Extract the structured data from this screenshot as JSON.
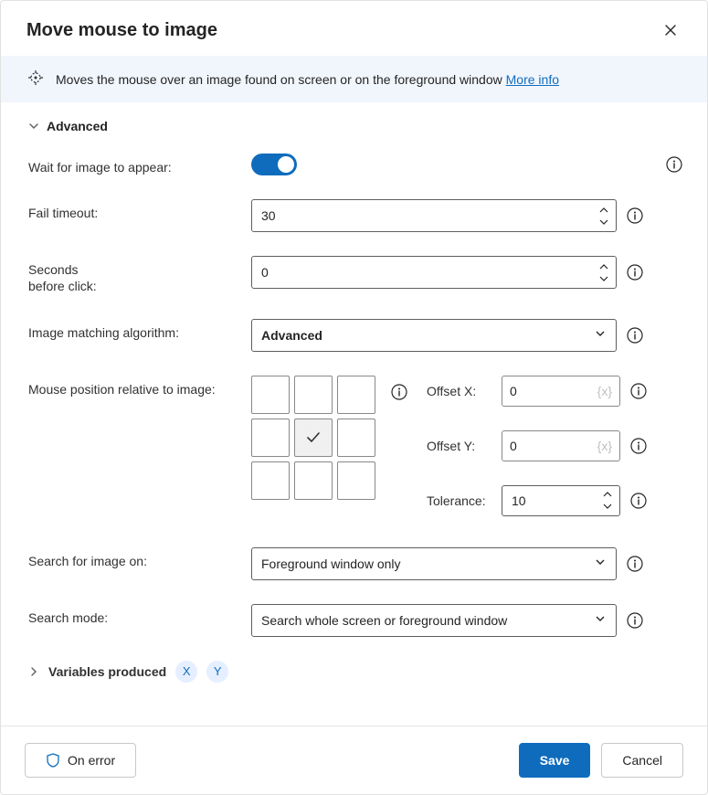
{
  "header": {
    "title": "Move mouse to image"
  },
  "banner": {
    "text": "Moves the mouse over an image found on screen or on the foreground window",
    "link": "More info"
  },
  "sections": {
    "advanced_label": "Advanced",
    "variables_label": "Variables produced",
    "var_chip_x": "X",
    "var_chip_y": "Y"
  },
  "labels": {
    "wait": "Wait for image to appear:",
    "fail_timeout": "Fail timeout:",
    "seconds_before": "Seconds\nbefore click:",
    "algorithm": "Image matching algorithm:",
    "mouse_pos": "Mouse position relative to image:",
    "offset_x": "Offset X:",
    "offset_y": "Offset Y:",
    "tolerance": "Tolerance:",
    "search_on": "Search for image on:",
    "search_mode": "Search mode:"
  },
  "values": {
    "fail_timeout": "30",
    "seconds_before": "0",
    "algorithm": "Advanced",
    "offset_x": "0",
    "offset_y": "0",
    "tolerance": "10",
    "search_on": "Foreground window only",
    "search_mode": "Search whole screen or foreground window"
  },
  "placeholders": {
    "var": "{x}"
  },
  "footer": {
    "on_error": "On error",
    "save": "Save",
    "cancel": "Cancel"
  }
}
